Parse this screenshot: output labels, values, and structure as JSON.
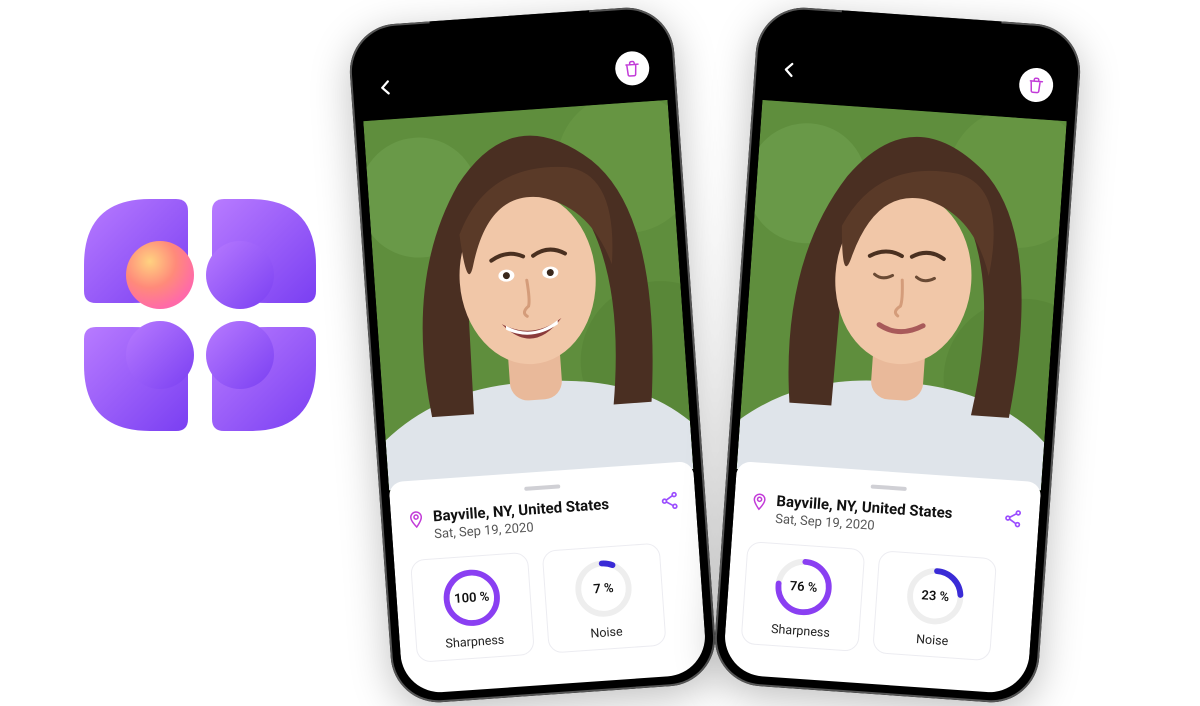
{
  "brand": {
    "accent": "#9b4dff",
    "accent2": "#6a3ff0"
  },
  "photo1": {
    "location": "Bayville, NY, United States",
    "date": "Sat, Sep 19, 2020",
    "metrics": {
      "sharpness": {
        "label": "Sharpness",
        "value_text": "100 %",
        "value": 100
      },
      "noise": {
        "label": "Noise",
        "value_text": "7 %",
        "value": 7
      }
    }
  },
  "photo2": {
    "location": "Bayville, NY, United States",
    "date": "Sat, Sep 19, 2020",
    "metrics": {
      "sharpness": {
        "label": "Sharpness",
        "value_text": "76 %",
        "value": 76
      },
      "noise": {
        "label": "Noise",
        "value_text": "23 %",
        "value": 23
      }
    }
  },
  "icons": {
    "back": "chevron-left-icon",
    "trash": "trash-icon",
    "pin": "location-pin-icon",
    "share": "share-icon"
  }
}
